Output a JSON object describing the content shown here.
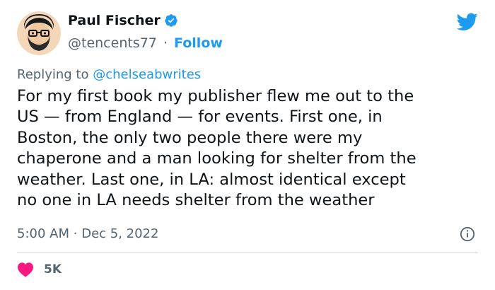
{
  "author": {
    "name": "Paul Fischer",
    "handle": "@tencents77",
    "separator": "·",
    "follow_label": "Follow"
  },
  "reply": {
    "prefix": "Replying to",
    "mention": "@chelseabwrites"
  },
  "tweet": {
    "text": "For my first book my publisher flew me out to the\nUS — from England — for events. First one, in\nBoston, the only two people there were my\nchaperone and a man looking for shelter from the\nweather. Last one, in LA: almost identical except\nno one in LA needs shelter from the weather",
    "time": "5:00 AM",
    "date_separator": "·",
    "date": "Dec 5, 2022"
  },
  "stats": {
    "likes": "5K"
  },
  "colors": {
    "accent": "#1d9bf0",
    "like": "#f91880",
    "muted": "#536471",
    "text": "#0f1419"
  },
  "icons": {
    "verified": "verified-badge-icon",
    "brand": "twitter-bird-icon",
    "info": "info-icon",
    "like": "heart-icon"
  }
}
